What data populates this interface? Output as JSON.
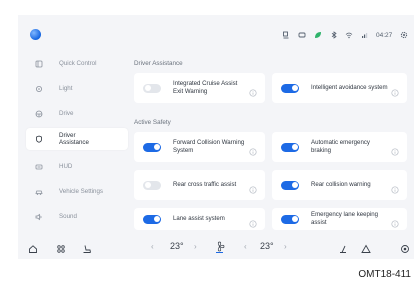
{
  "status_bar": {
    "time": "04:27"
  },
  "sidebar": {
    "items": [
      {
        "label": "Quick Control",
        "icon": "quick-control-icon",
        "active": false
      },
      {
        "label": "Light",
        "icon": "light-icon",
        "active": false
      },
      {
        "label": "Drive",
        "icon": "steering-wheel-icon",
        "active": false
      },
      {
        "label": "Driver Assistance",
        "icon": "driver-assistance-icon",
        "active": true
      },
      {
        "label": "HUD",
        "icon": "hud-icon",
        "active": false
      },
      {
        "label": "Vehicle Settings",
        "icon": "vehicle-icon",
        "active": false
      },
      {
        "label": "Sound",
        "icon": "speaker-icon",
        "active": false
      }
    ]
  },
  "main": {
    "sections": [
      {
        "title": "Driver Assistance"
      },
      {
        "title": "Active Safety"
      }
    ],
    "cards": [
      {
        "label": "Integrated Cruise Assist Exit Warning",
        "on": false
      },
      {
        "label": "Intelligent avoidance system",
        "on": true
      },
      {
        "label": "Forward Collision Warning System",
        "on": true
      },
      {
        "label": "Automatic emergency braking",
        "on": true
      },
      {
        "label": "Rear cross traffic assist",
        "on": false
      },
      {
        "label": "Rear collision warning",
        "on": true
      },
      {
        "label": "Lane assist system",
        "on": true
      },
      {
        "label": "Emergency lane keeping assist",
        "on": true
      }
    ]
  },
  "bottom_bar": {
    "temp_left": "23°",
    "temp_right": "23°"
  },
  "caption": "OMT18-411",
  "colors": {
    "accent": "#1d6ae5",
    "background": "#f4f5f8",
    "card": "#ffffff"
  }
}
